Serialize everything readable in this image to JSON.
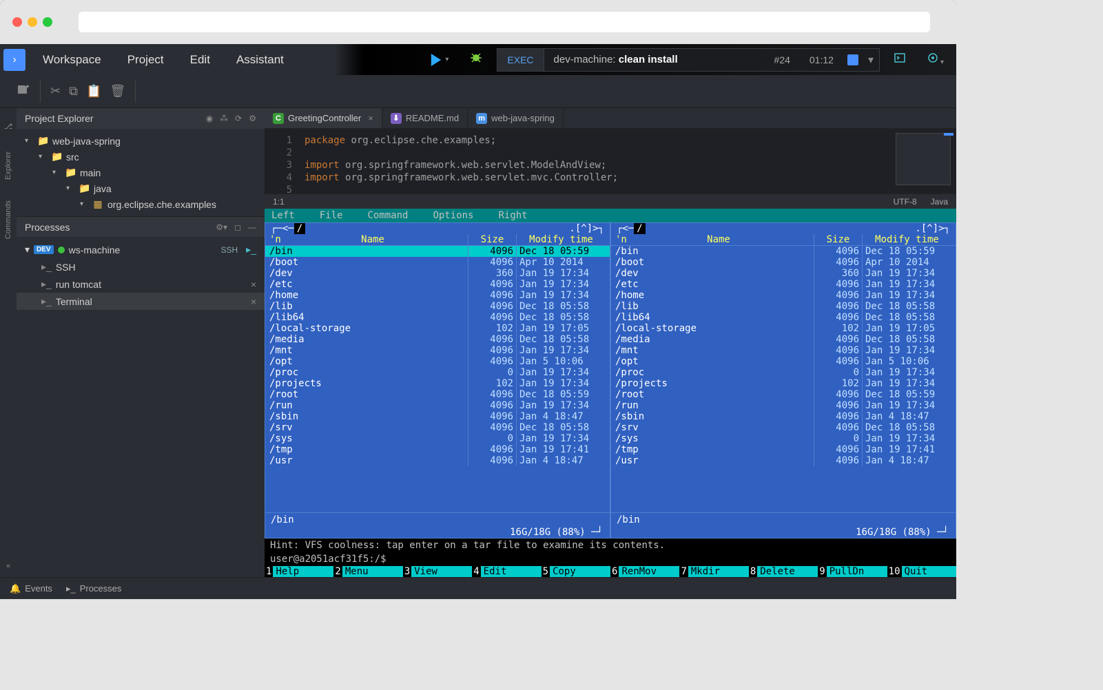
{
  "menus": [
    "Workspace",
    "Project",
    "Edit",
    "Assistant"
  ],
  "exec": {
    "label": "EXEC",
    "prefix": "dev-machine: ",
    "cmd": "clean install",
    "id": "#24",
    "time": "01:12"
  },
  "projectExplorer": {
    "title": "Project Explorer",
    "tree": [
      {
        "indent": 0,
        "icon": "📁",
        "color": "#4aa0ff",
        "name": "web-java-spring",
        "open": true
      },
      {
        "indent": 1,
        "icon": "📁",
        "color": "#e0b050",
        "name": "src",
        "open": true
      },
      {
        "indent": 2,
        "icon": "📁",
        "color": "#e0b050",
        "name": "main",
        "open": true
      },
      {
        "indent": 3,
        "icon": "📁",
        "color": "#4aa0ff",
        "name": "java",
        "open": true
      },
      {
        "indent": 4,
        "icon": "▦",
        "color": "#e0b050",
        "name": "org.eclipse.che.examples",
        "open": true
      }
    ]
  },
  "processes": {
    "title": "Processes",
    "machine": "ws-machine",
    "sshLabel": "SSH",
    "items": [
      {
        "name": "SSH",
        "closable": false
      },
      {
        "name": "run tomcat",
        "closable": true
      },
      {
        "name": "Terminal",
        "closable": true,
        "selected": true
      }
    ]
  },
  "tabs": [
    {
      "icon": "C",
      "iconbg": "#3a9b3a",
      "name": "GreetingController",
      "active": true,
      "closable": true
    },
    {
      "icon": "⬇",
      "iconbg": "#7b5fc0",
      "name": "README.md"
    },
    {
      "icon": "m",
      "iconbg": "#4a90e2",
      "name": "web-java-spring"
    }
  ],
  "code": {
    "lines": [
      {
        "n": 1,
        "segs": [
          {
            "t": "package ",
            "c": "kw"
          },
          {
            "t": "org.eclipse.che.examples;",
            "c": "pkg"
          }
        ]
      },
      {
        "n": 2,
        "segs": [
          {
            "t": "",
            "c": ""
          }
        ]
      },
      {
        "n": 3,
        "segs": [
          {
            "t": "import ",
            "c": "kw"
          },
          {
            "t": "org.springframework.web.servlet.ModelAndView;",
            "c": "pkg"
          }
        ]
      },
      {
        "n": 4,
        "segs": [
          {
            "t": "import ",
            "c": "kw"
          },
          {
            "t": "org.springframework.web.servlet.mvc.Controller;",
            "c": "pkg"
          }
        ]
      },
      {
        "n": 5,
        "segs": [
          {
            "t": "",
            "c": ""
          }
        ]
      }
    ],
    "cursor": "1:1",
    "encoding": "UTF-8",
    "lang": "Java"
  },
  "mc": {
    "menu": [
      "Left",
      "File",
      "Command",
      "Options",
      "Right"
    ],
    "path": "/",
    "header": {
      "n": "'n",
      "name": "Name",
      "size": "Size",
      "mtime": "Modify time"
    },
    "rows": [
      {
        "name": "/bin",
        "size": "4096",
        "mtime": "Dec 18 05:59",
        "sel": true
      },
      {
        "name": "/boot",
        "size": "4096",
        "mtime": "Apr 10  2014"
      },
      {
        "name": "/dev",
        "size": "360",
        "mtime": "Jan 19 17:34"
      },
      {
        "name": "/etc",
        "size": "4096",
        "mtime": "Jan 19 17:34"
      },
      {
        "name": "/home",
        "size": "4096",
        "mtime": "Jan 19 17:34"
      },
      {
        "name": "/lib",
        "size": "4096",
        "mtime": "Dec 18 05:58"
      },
      {
        "name": "/lib64",
        "size": "4096",
        "mtime": "Dec 18 05:58"
      },
      {
        "name": "/local-storage",
        "size": "102",
        "mtime": "Jan 19 17:05"
      },
      {
        "name": "/media",
        "size": "4096",
        "mtime": "Dec 18 05:58"
      },
      {
        "name": "/mnt",
        "size": "4096",
        "mtime": "Jan 19 17:34"
      },
      {
        "name": "/opt",
        "size": "4096",
        "mtime": "Jan  5 10:06"
      },
      {
        "name": "/proc",
        "size": "0",
        "mtime": "Jan 19 17:34"
      },
      {
        "name": "/projects",
        "size": "102",
        "mtime": "Jan 19 17:34"
      },
      {
        "name": "/root",
        "size": "4096",
        "mtime": "Dec 18 05:59"
      },
      {
        "name": "/run",
        "size": "4096",
        "mtime": "Jan 19 17:34"
      },
      {
        "name": "/sbin",
        "size": "4096",
        "mtime": "Jan  4 18:47"
      },
      {
        "name": "/srv",
        "size": "4096",
        "mtime": "Dec 18 05:58"
      },
      {
        "name": "/sys",
        "size": "0",
        "mtime": "Jan 19 17:34"
      },
      {
        "name": "/tmp",
        "size": "4096",
        "mtime": "Jan 19 17:41"
      },
      {
        "name": "/usr",
        "size": "4096",
        "mtime": "Jan  4 18:47"
      }
    ],
    "current": "/bin",
    "stat": "16G/18G (88%)",
    "hint": "Hint: VFS coolness: tap enter on a tar file to examine its contents.",
    "prompt": "user@a2051acf31f5:/$",
    "fkeys": [
      {
        "n": "1",
        "l": "Help"
      },
      {
        "n": "2",
        "l": "Menu"
      },
      {
        "n": "3",
        "l": "View"
      },
      {
        "n": "4",
        "l": "Edit"
      },
      {
        "n": "5",
        "l": "Copy"
      },
      {
        "n": "6",
        "l": "RenMov"
      },
      {
        "n": "7",
        "l": "Mkdir"
      },
      {
        "n": "8",
        "l": "Delete"
      },
      {
        "n": "9",
        "l": "PullDn"
      },
      {
        "n": "10",
        "l": "Quit"
      }
    ]
  },
  "leftrail": [
    "Explorer",
    "Commands"
  ],
  "statusbar": [
    {
      "icon": "🔔",
      "label": "Events"
    },
    {
      "icon": "▸_",
      "label": "Processes"
    }
  ]
}
